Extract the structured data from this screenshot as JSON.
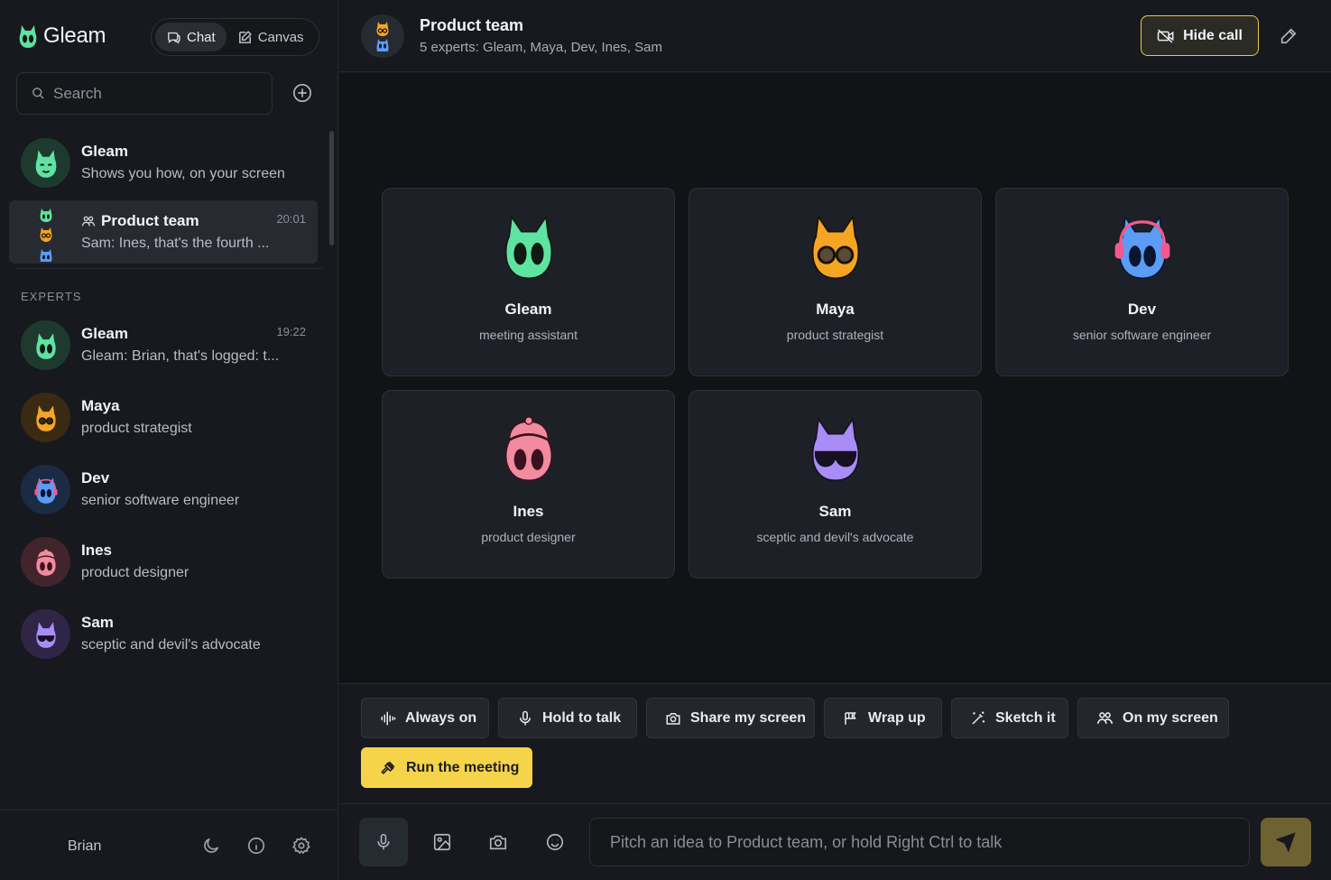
{
  "app": {
    "name": "Gleam"
  },
  "mode_toggle": {
    "chat_label": "Chat",
    "canvas_label": "Canvas",
    "active": "Chat"
  },
  "search": {
    "placeholder": "Search"
  },
  "conversations": [
    {
      "name": "Gleam",
      "subtitle": "Shows you how, on your screen",
      "time": ""
    },
    {
      "name": "Product team",
      "subtitle": "Sam: Ines, that's the fourth ...",
      "time": "20:01",
      "selected": true
    }
  ],
  "experts_section": {
    "label": "EXPERTS"
  },
  "experts": [
    {
      "name": "Gleam",
      "subtitle": "Gleam: Brian, that's logged: t...",
      "time": "19:22",
      "color": "#5fe3a1"
    },
    {
      "name": "Maya",
      "subtitle": "product strategist",
      "time": "",
      "color": "#f5a524"
    },
    {
      "name": "Dev",
      "subtitle": "senior software engineer",
      "time": "",
      "color": "#5b9cf5"
    },
    {
      "name": "Ines",
      "subtitle": "product designer",
      "time": "",
      "color": "#f28aa0"
    },
    {
      "name": "Sam",
      "subtitle": "sceptic and devil's advocate",
      "time": "",
      "color": "#a98cf5"
    }
  ],
  "footer": {
    "user": "Brian",
    "icons": [
      "moon-icon",
      "info-icon",
      "settings-icon"
    ]
  },
  "header": {
    "title": "Product team",
    "subtitle": "5 experts: Gleam, Maya, Dev, Ines, Sam",
    "hide_call_label": "Hide call"
  },
  "participants": [
    {
      "name": "Gleam",
      "role": "meeting assistant",
      "color": "#5fe3a1"
    },
    {
      "name": "Maya",
      "role": "product strategist",
      "color": "#f5a524"
    },
    {
      "name": "Dev",
      "role": "senior software engineer",
      "color": "#5b9cf5"
    },
    {
      "name": "Ines",
      "role": "product designer",
      "color": "#f28aa0"
    },
    {
      "name": "Sam",
      "role": "sceptic and devil's advocate",
      "color": "#a98cf5"
    }
  ],
  "actions": [
    {
      "label": "Always on",
      "icon": "waveform-icon"
    },
    {
      "label": "Hold to talk",
      "icon": "microphone-icon"
    },
    {
      "label": "Share my screen",
      "icon": "camera-icon"
    },
    {
      "label": "Wrap up",
      "icon": "flag-icon"
    },
    {
      "label": "Sketch it",
      "icon": "magic-wand-icon"
    },
    {
      "label": "On my screen",
      "icon": "people-icon"
    },
    {
      "label": "Run the meeting",
      "icon": "gavel-icon",
      "primary": true
    }
  ],
  "composer": {
    "placeholder": "Pitch an idea to Product team, or hold Right Ctrl to talk"
  },
  "colors": {
    "accent": "#f6d44a",
    "background": "#111316",
    "panel": "#17191e"
  }
}
